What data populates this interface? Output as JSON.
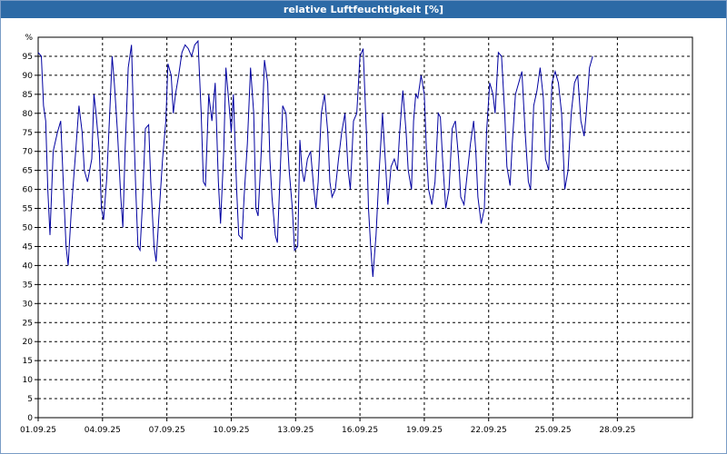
{
  "title": "relative Luftfeuchtigkeit [%]",
  "colors": {
    "titlebar": "#2c6aa6",
    "line": "#0000a0",
    "grid": "#000000"
  },
  "chart_data": {
    "type": "line",
    "title": "relative Luftfeuchtigkeit [%]",
    "ylabel": "%",
    "xlabel": "",
    "ylim": [
      0,
      100
    ],
    "grid": true,
    "legend": "none",
    "yticks": [
      0,
      5,
      10,
      15,
      20,
      25,
      30,
      35,
      40,
      45,
      50,
      55,
      60,
      65,
      70,
      75,
      80,
      85,
      90,
      95
    ],
    "yticklabels": [
      "0",
      "5",
      "10",
      "15",
      "20",
      "25",
      "30",
      "35",
      "40",
      "45",
      "50",
      "55",
      "60",
      "65",
      "70",
      "75",
      "80",
      "85",
      "90",
      "95"
    ],
    "ytop_label": "%",
    "xdomain": [
      "01.09.25",
      "01.10.25"
    ],
    "xticks": [
      "01.09.25",
      "04.09.25",
      "07.09.25",
      "10.09.25",
      "13.09.25",
      "16.09.25",
      "19.09.25",
      "22.09.25",
      "25.09.25",
      "28.09.25"
    ],
    "series": [
      {
        "values": [
          [
            0.0,
            96
          ],
          [
            0.15,
            95
          ],
          [
            0.25,
            82
          ],
          [
            0.35,
            78
          ],
          [
            0.45,
            60
          ],
          [
            0.55,
            48
          ],
          [
            0.7,
            70
          ],
          [
            0.9,
            75
          ],
          [
            1.05,
            78
          ],
          [
            1.2,
            58
          ],
          [
            1.3,
            45
          ],
          [
            1.4,
            40
          ],
          [
            1.55,
            55
          ],
          [
            1.75,
            70
          ],
          [
            1.9,
            82
          ],
          [
            2.05,
            75
          ],
          [
            2.15,
            65
          ],
          [
            2.3,
            62
          ],
          [
            2.5,
            68
          ],
          [
            2.6,
            85
          ],
          [
            2.7,
            80
          ],
          [
            2.85,
            70
          ],
          [
            2.95,
            55
          ],
          [
            3.05,
            52
          ],
          [
            3.2,
            63
          ],
          [
            3.35,
            82
          ],
          [
            3.45,
            95
          ],
          [
            3.55,
            88
          ],
          [
            3.7,
            75
          ],
          [
            3.85,
            58
          ],
          [
            3.95,
            50
          ],
          [
            4.05,
            70
          ],
          [
            4.2,
            92
          ],
          [
            4.35,
            98
          ],
          [
            4.45,
            78
          ],
          [
            4.55,
            60
          ],
          [
            4.65,
            45
          ],
          [
            4.75,
            44
          ],
          [
            4.85,
            55
          ],
          [
            5.0,
            76
          ],
          [
            5.15,
            77
          ],
          [
            5.25,
            62
          ],
          [
            5.4,
            45
          ],
          [
            5.5,
            41
          ],
          [
            5.65,
            55
          ],
          [
            5.8,
            68
          ],
          [
            5.95,
            78
          ],
          [
            6.05,
            93
          ],
          [
            6.2,
            90
          ],
          [
            6.3,
            80
          ],
          [
            6.4,
            85
          ],
          [
            6.55,
            90
          ],
          [
            6.7,
            96
          ],
          [
            6.85,
            98
          ],
          [
            7.0,
            97
          ],
          [
            7.15,
            95
          ],
          [
            7.3,
            98
          ],
          [
            7.45,
            99
          ],
          [
            7.6,
            80
          ],
          [
            7.7,
            62
          ],
          [
            7.8,
            61
          ],
          [
            7.95,
            85
          ],
          [
            8.1,
            78
          ],
          [
            8.25,
            88
          ],
          [
            8.4,
            62
          ],
          [
            8.5,
            51
          ],
          [
            8.65,
            70
          ],
          [
            8.75,
            92
          ],
          [
            8.9,
            82
          ],
          [
            9.0,
            75
          ],
          [
            9.1,
            85
          ],
          [
            9.25,
            60
          ],
          [
            9.35,
            48
          ],
          [
            9.5,
            47
          ],
          [
            9.6,
            58
          ],
          [
            9.75,
            72
          ],
          [
            9.9,
            92
          ],
          [
            10.05,
            80
          ],
          [
            10.15,
            55
          ],
          [
            10.25,
            53
          ],
          [
            10.4,
            70
          ],
          [
            10.55,
            94
          ],
          [
            10.7,
            88
          ],
          [
            10.8,
            68
          ],
          [
            10.9,
            58
          ],
          [
            11.05,
            48
          ],
          [
            11.15,
            46
          ],
          [
            11.25,
            60
          ],
          [
            11.4,
            82
          ],
          [
            11.55,
            80
          ],
          [
            11.7,
            65
          ],
          [
            11.85,
            55
          ],
          [
            11.95,
            44
          ],
          [
            12.1,
            45
          ],
          [
            12.2,
            73
          ],
          [
            12.3,
            65
          ],
          [
            12.4,
            62
          ],
          [
            12.55,
            68
          ],
          [
            12.7,
            70
          ],
          [
            12.85,
            60
          ],
          [
            12.95,
            55
          ],
          [
            13.05,
            62
          ],
          [
            13.2,
            80
          ],
          [
            13.35,
            85
          ],
          [
            13.5,
            75
          ],
          [
            13.6,
            62
          ],
          [
            13.7,
            58
          ],
          [
            13.85,
            60
          ],
          [
            14.0,
            68
          ],
          [
            14.15,
            75
          ],
          [
            14.3,
            80
          ],
          [
            14.45,
            65
          ],
          [
            14.55,
            60
          ],
          [
            14.7,
            78
          ],
          [
            14.85,
            80
          ],
          [
            15.0,
            95
          ],
          [
            15.15,
            97
          ],
          [
            15.3,
            75
          ],
          [
            15.4,
            55
          ],
          [
            15.5,
            45
          ],
          [
            15.6,
            37
          ],
          [
            15.75,
            48
          ],
          [
            15.9,
            65
          ],
          [
            16.05,
            80
          ],
          [
            16.2,
            66
          ],
          [
            16.3,
            56
          ],
          [
            16.45,
            66
          ],
          [
            16.6,
            68
          ],
          [
            16.75,
            65
          ],
          [
            16.85,
            75
          ],
          [
            17.0,
            86
          ],
          [
            17.15,
            75
          ],
          [
            17.25,
            65
          ],
          [
            17.4,
            60
          ],
          [
            17.5,
            78
          ],
          [
            17.6,
            85
          ],
          [
            17.7,
            84
          ],
          [
            17.85,
            90
          ],
          [
            18.0,
            85
          ],
          [
            18.1,
            70
          ],
          [
            18.2,
            60
          ],
          [
            18.35,
            56
          ],
          [
            18.5,
            62
          ],
          [
            18.65,
            80
          ],
          [
            18.75,
            79
          ],
          [
            18.85,
            68
          ],
          [
            19.0,
            55
          ],
          [
            19.15,
            60
          ],
          [
            19.3,
            76
          ],
          [
            19.45,
            78
          ],
          [
            19.6,
            68
          ],
          [
            19.7,
            58
          ],
          [
            19.85,
            56
          ],
          [
            20.0,
            64
          ],
          [
            20.15,
            72
          ],
          [
            20.3,
            78
          ],
          [
            20.4,
            70
          ],
          [
            20.5,
            58
          ],
          [
            20.65,
            51
          ],
          [
            20.8,
            55
          ],
          [
            20.9,
            75
          ],
          [
            21.05,
            88
          ],
          [
            21.2,
            85
          ],
          [
            21.3,
            80
          ],
          [
            21.45,
            96
          ],
          [
            21.6,
            95
          ],
          [
            21.75,
            80
          ],
          [
            21.85,
            66
          ],
          [
            22.0,
            61
          ],
          [
            22.1,
            72
          ],
          [
            22.25,
            85
          ],
          [
            22.4,
            88
          ],
          [
            22.55,
            91
          ],
          [
            22.7,
            75
          ],
          [
            22.85,
            62
          ],
          [
            22.95,
            60
          ],
          [
            23.1,
            82
          ],
          [
            23.25,
            86
          ],
          [
            23.4,
            92
          ],
          [
            23.55,
            84
          ],
          [
            23.65,
            68
          ],
          [
            23.8,
            65
          ],
          [
            23.95,
            88
          ],
          [
            24.1,
            91
          ],
          [
            24.25,
            88
          ],
          [
            24.4,
            80
          ],
          [
            24.55,
            60
          ],
          [
            24.7,
            65
          ],
          [
            24.85,
            80
          ],
          [
            25.0,
            88
          ],
          [
            25.15,
            90
          ],
          [
            25.3,
            78
          ],
          [
            25.45,
            74
          ],
          [
            25.55,
            80
          ],
          [
            25.7,
            92
          ],
          [
            25.85,
            95
          ]
        ]
      }
    ]
  }
}
